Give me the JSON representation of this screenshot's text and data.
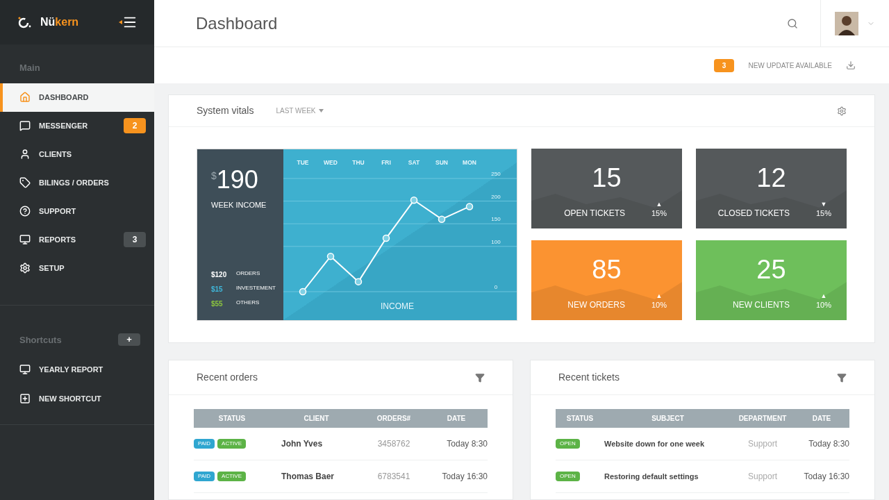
{
  "brand": {
    "prefix": "Nü",
    "suffix": "kern"
  },
  "sidebar": {
    "main_heading": "Main",
    "items": [
      {
        "label": "DASHBOARD",
        "selected": true
      },
      {
        "label": "MESSENGER",
        "selected": false,
        "badge": {
          "text": "2",
          "color": "#f7931e"
        }
      },
      {
        "label": "CLIENTS",
        "selected": false
      },
      {
        "label": "BILINGS / ORDERS",
        "selected": false
      },
      {
        "label": "SUPPORT",
        "selected": false
      },
      {
        "label": "REPORTS",
        "selected": false,
        "badge": {
          "text": "3",
          "color": "#4b5052"
        }
      },
      {
        "label": "SETUP",
        "selected": false
      }
    ],
    "shortcuts_heading": "Shortcuts",
    "add_label": "+",
    "shortcuts": [
      {
        "label": "YEARLY REPORT"
      },
      {
        "label": "NEW SHORTCUT"
      }
    ]
  },
  "header": {
    "title": "Dashboard"
  },
  "update": {
    "count": "3",
    "label": "NEW UPDATE AVAILABLE"
  },
  "vitals": {
    "title": "System vitals",
    "period": "LAST WEEK",
    "amount_currency": "$",
    "amount": "190",
    "amount_label": "WEEK INCOME",
    "breakdown": [
      {
        "amount": "$120",
        "label": "ORDERS",
        "color": "#ffffff"
      },
      {
        "amount": "$15",
        "label": "INVESTEMENT",
        "color": "#3fb6d9"
      },
      {
        "amount": "$55",
        "label": "OTHERS",
        "color": "#8cc43f"
      }
    ],
    "chart_data": {
      "type": "line",
      "xlabel": "INCOME",
      "categories": [
        "TUE",
        "WED",
        "THU",
        "FRI",
        "SAT",
        "SUN",
        "MON"
      ],
      "ylim": [
        0,
        250
      ],
      "yticks": [
        0,
        100,
        150,
        200,
        250
      ],
      "grid": true,
      "series": [
        {
          "color": "#ffffff",
          "marker": true,
          "values": [
            0,
            78,
            22,
            118,
            202,
            160,
            188
          ]
        }
      ]
    }
  },
  "tiles": [
    {
      "value": "15",
      "label": "OPEN TICKETS",
      "arrow": "▲",
      "change": "15%",
      "color": "#55595b"
    },
    {
      "value": "12",
      "label": "CLOSED TICKETS",
      "arrow": "▼",
      "change": "15%",
      "color": "#55595b"
    },
    {
      "value": "85",
      "label": "NEW ORDERS",
      "arrow": "▲",
      "change": "10%",
      "color": "#fb9331"
    },
    {
      "value": "25",
      "label": "NEW CLIENTS",
      "arrow": "▲",
      "change": "10%",
      "color": "#6ebf5b"
    }
  ],
  "orders": {
    "title": "Recent orders",
    "columns": [
      "STATUS",
      "CLIENT",
      "ORDERS#",
      "DATE"
    ],
    "rows": [
      {
        "tags": [
          {
            "text": "PAID",
            "color": "#2fa6d0"
          },
          {
            "text": "ACTIVE",
            "color": "#5cb346"
          }
        ],
        "client": "John Yves",
        "order": "3458762",
        "date": "Today 8:30"
      },
      {
        "tags": [
          {
            "text": "PAID",
            "color": "#2fa6d0"
          },
          {
            "text": "ACTIVE",
            "color": "#5cb346"
          }
        ],
        "client": "Thomas Baer",
        "order": "6783541",
        "date": "Today 16:30"
      }
    ]
  },
  "tickets": {
    "title": "Recent tickets",
    "columns": [
      "STATUS",
      "SUBJECT",
      "DEPARTMENT",
      "DATE"
    ],
    "rows": [
      {
        "tags": [
          {
            "text": "OPEN",
            "color": "#5cb346"
          }
        ],
        "subject": "Website down for one week",
        "department": "Support",
        "date": "Today 8:30"
      },
      {
        "tags": [
          {
            "text": "OPEN",
            "color": "#5cb346"
          }
        ],
        "subject": "Restoring default settings",
        "department": "Support",
        "date": "Today 16:30"
      }
    ]
  }
}
